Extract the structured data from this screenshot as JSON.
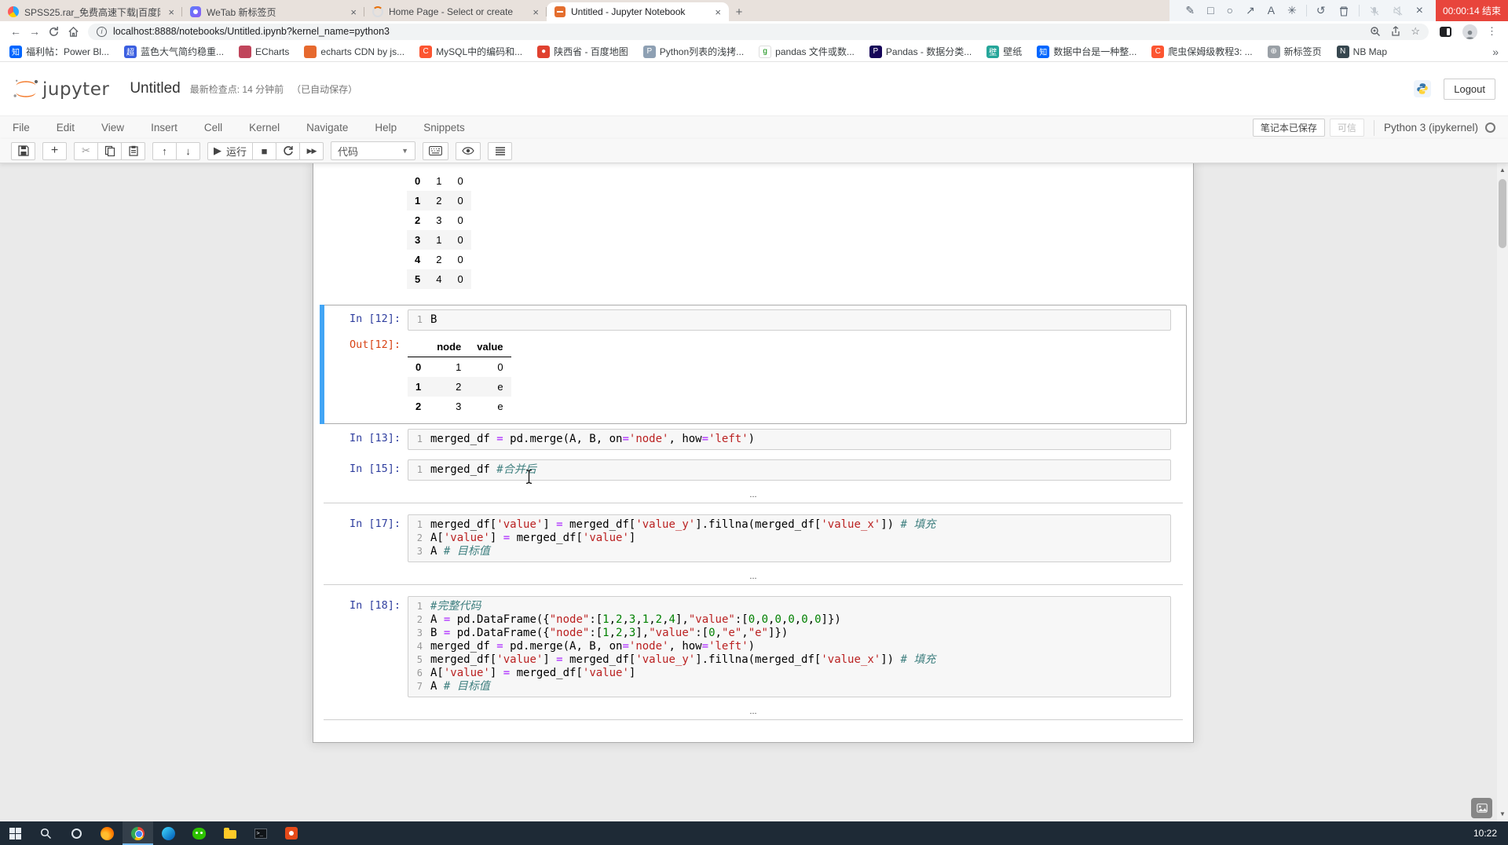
{
  "browser": {
    "tabs": [
      {
        "title": "SPSS25.rar_免费高速下载|百度网盘",
        "icon": "baidu-pan-icon",
        "active": false
      },
      {
        "title": "WeTab 新标签页",
        "icon": "wetab-icon",
        "active": false
      },
      {
        "title": "Home Page - Select or create",
        "icon": "loading-spinner-icon",
        "active": false
      },
      {
        "title": "Untitled - Jupyter Notebook",
        "icon": "jupyter-favicon",
        "active": true
      }
    ],
    "toolbar": {
      "url": "localhost:8888/notebooks/Untitled.ipynb?kernel_name=python3"
    },
    "bookmarks": [
      {
        "label": "福利帖：Power Bl...",
        "icon": "zhihu-icon",
        "bg": "#0066ff",
        "glyph": "知"
      },
      {
        "label": "蓝色大气简约稳重...",
        "icon": "chao-icon",
        "bg": "#3b5fe0",
        "glyph": "超"
      },
      {
        "label": "ECharts",
        "icon": "echarts-icon",
        "bg": "#c0455b",
        "glyph": ""
      },
      {
        "label": "echarts CDN by js...",
        "icon": "cdn-icon",
        "bg": "#e6692e",
        "glyph": ""
      },
      {
        "label": "MySQL中的编码和...",
        "icon": "csdn-icon",
        "bg": "#fc5531",
        "glyph": "C"
      },
      {
        "label": "陕西省 - 百度地图",
        "icon": "map-pin-icon",
        "bg": "#e0412f",
        "glyph": "●"
      },
      {
        "label": "Python列表的浅拷...",
        "icon": "doc-icon",
        "bg": "#8ea0b3",
        "glyph": "P"
      },
      {
        "label": "pandas 文件或数...",
        "icon": "green-g-icon",
        "bg": "#ffffff",
        "glyph": "g",
        "fg": "#0a8a0a"
      },
      {
        "label": "Pandas - 数据分类...",
        "icon": "pandas-icon",
        "bg": "#150458",
        "glyph": "P"
      },
      {
        "label": "壁纸",
        "icon": "wallpaper-icon",
        "bg": "#26a69a",
        "glyph": "壁"
      },
      {
        "label": "数据中台是一种整...",
        "icon": "zhihu-icon",
        "bg": "#0066ff",
        "glyph": "知"
      },
      {
        "label": "爬虫保姆级教程3: ...",
        "icon": "csdn-icon",
        "bg": "#fc5531",
        "glyph": "C"
      },
      {
        "label": "新标签页",
        "icon": "globe-icon",
        "bg": "#9aa0a6",
        "glyph": "⊕"
      },
      {
        "label": "NB Map",
        "icon": "nb-icon",
        "bg": "#37474f",
        "glyph": "N"
      }
    ],
    "recorder": {
      "timer": "00:00:14 结束"
    }
  },
  "jupyter": {
    "header": {
      "logo": "jupyter",
      "title": "Untitled",
      "checkpoint": "最新检查点: 14 分钟前",
      "autosave": "（已自动保存）",
      "logout": "Logout"
    },
    "menubar": {
      "items": [
        "File",
        "Edit",
        "View",
        "Insert",
        "Cell",
        "Kernel",
        "Navigate",
        "Help",
        "Snippets"
      ],
      "saved": "笔记本已保存",
      "trusted": "可信",
      "kernel_name": "Python 3 (ipykernel)"
    },
    "toolbar": {
      "run": "运行",
      "cell_type": "代码"
    }
  },
  "notebook": {
    "collapsed_placeholder": "...",
    "scrolled_table": {
      "rows": [
        [
          "0",
          "1",
          "0"
        ],
        [
          "1",
          "2",
          "0"
        ],
        [
          "2",
          "3",
          "0"
        ],
        [
          "3",
          "1",
          "0"
        ],
        [
          "4",
          "2",
          "0"
        ],
        [
          "5",
          "4",
          "0"
        ]
      ]
    },
    "cells": [
      {
        "prompt": "In [12]:",
        "selected": true,
        "source": [
          [
            [
              "B",
              ""
            ]
          ]
        ],
        "output": {
          "prompt": "Out[12]:",
          "columns": [
            "node",
            "value"
          ],
          "rows": [
            [
              "0",
              "1",
              "0"
            ],
            [
              "1",
              "2",
              "e"
            ],
            [
              "2",
              "3",
              "e"
            ]
          ]
        }
      },
      {
        "prompt": "In [13]:",
        "source": [
          [
            [
              "merged_df ",
              ""
            ],
            [
              "=",
              "op"
            ],
            [
              " pd.merge(A, B, on",
              ""
            ],
            [
              "=",
              "op"
            ],
            [
              "'node'",
              "str"
            ],
            [
              ", how",
              ""
            ],
            [
              "=",
              "op"
            ],
            [
              "'left'",
              "str"
            ],
            [
              ")",
              ""
            ]
          ]
        ]
      },
      {
        "prompt": "In [15]:",
        "source": [
          [
            [
              "merged_df ",
              ""
            ],
            [
              "#合并后",
              "cmt"
            ]
          ]
        ],
        "collapsed_output": true
      },
      {
        "prompt": "In [17]:",
        "source": [
          [
            [
              "merged_df[",
              ""
            ],
            [
              "'value'",
              "str"
            ],
            [
              "] ",
              ""
            ],
            [
              "=",
              "op"
            ],
            [
              " merged_df[",
              ""
            ],
            [
              "'value_y'",
              "str"
            ],
            [
              "].fillna(merged_df[",
              ""
            ],
            [
              "'value_x'",
              "str"
            ],
            [
              "]) ",
              ""
            ],
            [
              "# 填充",
              "cmt"
            ]
          ],
          [
            [
              "A[",
              ""
            ],
            [
              "'value'",
              "str"
            ],
            [
              "] ",
              ""
            ],
            [
              "=",
              "op"
            ],
            [
              " merged_df[",
              ""
            ],
            [
              "'value'",
              "str"
            ],
            [
              "]",
              ""
            ]
          ],
          [
            [
              "A ",
              ""
            ],
            [
              "# 目标值",
              "cmt"
            ]
          ]
        ],
        "collapsed_output": true
      },
      {
        "prompt": "In [18]:",
        "source": [
          [
            [
              "#完整代码",
              "cmt"
            ]
          ],
          [
            [
              "A ",
              ""
            ],
            [
              "=",
              "op"
            ],
            [
              " pd.DataFrame({",
              ""
            ],
            [
              "\"node\"",
              "str"
            ],
            [
              ":[",
              ""
            ],
            [
              "1",
              "num"
            ],
            [
              ",",
              ""
            ],
            [
              "2",
              "num"
            ],
            [
              ",",
              ""
            ],
            [
              "3",
              "num"
            ],
            [
              ",",
              ""
            ],
            [
              "1",
              "num"
            ],
            [
              ",",
              ""
            ],
            [
              "2",
              "num"
            ],
            [
              ",",
              ""
            ],
            [
              "4",
              "num"
            ],
            [
              "],",
              ""
            ],
            [
              "\"value\"",
              "str"
            ],
            [
              ":[",
              ""
            ],
            [
              "0",
              "num"
            ],
            [
              ",",
              ""
            ],
            [
              "0",
              "num"
            ],
            [
              ",",
              ""
            ],
            [
              "0",
              "num"
            ],
            [
              ",",
              ""
            ],
            [
              "0",
              "num"
            ],
            [
              ",",
              ""
            ],
            [
              "0",
              "num"
            ],
            [
              ",",
              ""
            ],
            [
              "0",
              "num"
            ],
            [
              "]})",
              ""
            ]
          ],
          [
            [
              "B ",
              ""
            ],
            [
              "=",
              "op"
            ],
            [
              " pd.DataFrame({",
              ""
            ],
            [
              "\"node\"",
              "str"
            ],
            [
              ":[",
              ""
            ],
            [
              "1",
              "num"
            ],
            [
              ",",
              ""
            ],
            [
              "2",
              "num"
            ],
            [
              ",",
              ""
            ],
            [
              "3",
              "num"
            ],
            [
              "],",
              ""
            ],
            [
              "\"value\"",
              "str"
            ],
            [
              ":[",
              ""
            ],
            [
              "0",
              "num"
            ],
            [
              ",",
              ""
            ],
            [
              "\"e\"",
              "str"
            ],
            [
              ",",
              ""
            ],
            [
              "\"e\"",
              "str"
            ],
            [
              "]})",
              ""
            ]
          ],
          [
            [
              "merged_df ",
              ""
            ],
            [
              "=",
              "op"
            ],
            [
              " pd.merge(A, B, on",
              ""
            ],
            [
              "=",
              "op"
            ],
            [
              "'node'",
              "str"
            ],
            [
              ", how",
              ""
            ],
            [
              "=",
              "op"
            ],
            [
              "'left'",
              "str"
            ],
            [
              ")",
              ""
            ]
          ],
          [
            [
              "merged_df[",
              ""
            ],
            [
              "'value'",
              "str"
            ],
            [
              "] ",
              ""
            ],
            [
              "=",
              "op"
            ],
            [
              " merged_df[",
              ""
            ],
            [
              "'value_y'",
              "str"
            ],
            [
              "].fillna(merged_df[",
              ""
            ],
            [
              "'value_x'",
              "str"
            ],
            [
              "]) ",
              ""
            ],
            [
              "# 填充",
              "cmt"
            ]
          ],
          [
            [
              "A[",
              ""
            ],
            [
              "'value'",
              "str"
            ],
            [
              "] ",
              ""
            ],
            [
              "=",
              "op"
            ],
            [
              " merged_df[",
              ""
            ],
            [
              "'value'",
              "str"
            ],
            [
              "]",
              ""
            ]
          ],
          [
            [
              "A ",
              ""
            ],
            [
              "# 目标值",
              "cmt"
            ]
          ]
        ],
        "collapsed_output": true
      }
    ]
  },
  "taskbar": {
    "time": "10:22"
  },
  "colors": {
    "selection_bar": "#42a5f5",
    "in_prompt": "#303f9f",
    "out_prompt": "#d84315",
    "string": "#ba2121",
    "operator": "#aa22ff",
    "number": "#008000",
    "comment": "#408080",
    "record_badge": "#e8453c",
    "taskbar_bg": "#1e2a36"
  }
}
